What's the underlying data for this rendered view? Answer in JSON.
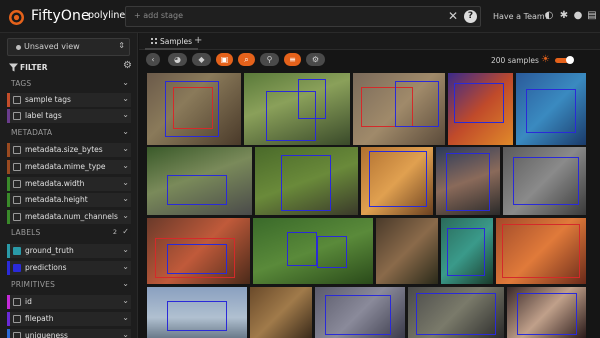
{
  "header": {
    "app_name": "FiftyOne",
    "dataset_name": "polylines",
    "stage_placeholder": "+ add stage",
    "team_link": "Have a Team?",
    "icons": [
      "close-icon",
      "help-icon",
      "dark-mode-icon",
      "slack-icon",
      "github-icon",
      "docs-icon"
    ]
  },
  "sidebar": {
    "saved_view": "Unsaved view",
    "filter_label": "FILTER",
    "sections": {
      "tags": "TAGS",
      "metadata": "METADATA",
      "labels": "LABELS",
      "labels_count": "2",
      "primitives": "PRIMITIVES"
    },
    "tags": [
      {
        "label": "sample tags",
        "color": "#c44d2a"
      },
      {
        "label": "label tags",
        "color": "#6a3c8c"
      }
    ],
    "metadata": [
      {
        "label": "metadata.size_bytes",
        "color": "#9a4a20"
      },
      {
        "label": "metadata.mime_type",
        "color": "#9a4a20"
      },
      {
        "label": "metadata.width",
        "color": "#3a8a2a"
      },
      {
        "label": "metadata.height",
        "color": "#3a8a2a"
      },
      {
        "label": "metadata.num_channels",
        "color": "#3a8a2a"
      }
    ],
    "labels": [
      {
        "label": "ground_truth",
        "color": "#2a9aa8",
        "checked": true
      },
      {
        "label": "predictions",
        "color": "#2a2ad8",
        "checked": true
      }
    ],
    "primitives": [
      {
        "label": "id",
        "color": "#c42ad8"
      },
      {
        "label": "filepath",
        "color": "#6a2ad8"
      },
      {
        "label": "uniqueness",
        "color": "#2a6ad8"
      }
    ]
  },
  "main": {
    "tab_label": "Samples",
    "sample_count": "200 samples"
  },
  "colors": {
    "accent": "#e5621b",
    "background": "#151515",
    "panel": "#1d1d1d",
    "prediction_box": "#2a2ad8",
    "ground_truth_box": "#d42a2a"
  }
}
